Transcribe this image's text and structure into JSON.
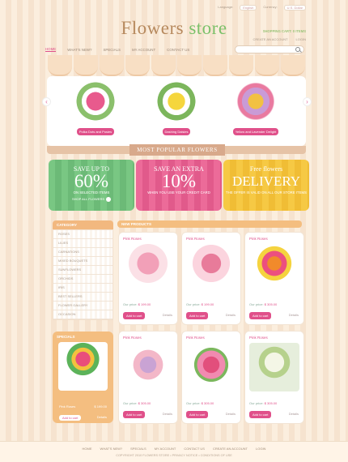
{
  "topbar": {
    "language": "Language:",
    "language_value": "English",
    "currency": "Currency:",
    "currency_value": "U.S. Dollar"
  },
  "logo": {
    "word1": "Flowers",
    "word2": "store"
  },
  "cart": {
    "label": "SHOPPING CART: 0 ITEMS"
  },
  "account": {
    "create": "CREATE AN ACCOUNT",
    "login": "LOGIN"
  },
  "nav": [
    "HOME",
    "WHAT'S NEW?",
    "SPECIALS",
    "MY ACCOUNT",
    "CONTACT US"
  ],
  "slider": [
    {
      "caption": "Polka Dots and Posies"
    },
    {
      "caption": "Dashing Daisies"
    },
    {
      "caption": "Yellow and Lavender Delight"
    }
  ],
  "section_title": "MOST POPULAR FLOWERS",
  "promos": [
    {
      "l1": "SAVE UP TO",
      "big": "60%",
      "sm": "ON SELECTED ITEMS",
      "shop": "SHOP ALL FLOWERS"
    },
    {
      "l1": "SAVE AN EXTRA",
      "big": "10%",
      "sm": "WHEN YOU USE YOUR CREDIT CARD"
    },
    {
      "l1": "Free flowers",
      "big": "DELIVERY",
      "sm": "THE OFFER IS VALID ON ALL OUR STORE ITEMS"
    }
  ],
  "category": {
    "title": "CATEGORY",
    "items": [
      "ROSES",
      "LILIES",
      "CARNATIONS",
      "MIXED BOUQUETS",
      "SUNFLOWERS",
      "ORCHIDS",
      "IRIS",
      "BEST SELLERS",
      "FLOWER GALLERY",
      "OCCASION"
    ]
  },
  "specials": {
    "title": "SPECIALS",
    "name": "Pink Roses",
    "price": "$ 199.00",
    "add": "Add to cart",
    "details": "Details"
  },
  "new_products": {
    "title": "NEW PRODUCTS",
    "items": [
      {
        "title": "Pink Roses",
        "price_label": "Our price:",
        "price": "$ 199.00",
        "add": "Add to cart",
        "details": "Details"
      },
      {
        "title": "Pink Roses",
        "price_label": "Our price:",
        "price": "$ 199.00",
        "add": "Add to cart",
        "details": "Details"
      },
      {
        "title": "Pink Roses",
        "price_label": "Our price:",
        "price": "$ 305.00",
        "add": "Add to cart",
        "details": "Details"
      },
      {
        "title": "Pink Roses",
        "price_label": "Our price:",
        "price": "$ 305.00",
        "add": "Add to cart",
        "details": "Details"
      },
      {
        "title": "Pink Roses",
        "price_label": "Our price:",
        "price": "$ 305.00",
        "add": "Add to cart",
        "details": "Details"
      },
      {
        "title": "Pink Roses",
        "price_label": "Our price:",
        "price": "$ 305.00",
        "add": "Add to cart",
        "details": "Details"
      }
    ]
  },
  "footer": {
    "links": [
      "HOME",
      "WHAT'S NEW?",
      "SPECIALS",
      "MY ACCOUNT",
      "CONTACT US",
      "CREATE AN ACCOUNT",
      "LOGIN"
    ],
    "copy": "COPYRIGHT 2010 FLOWERS STORE • PRIVACY NOTICE • CONDITIONS OF USE"
  },
  "colors": {
    "accent": "#e0508a",
    "orange": "#f4be80",
    "green": "#79c783",
    "yellow": "#f6c944"
  }
}
